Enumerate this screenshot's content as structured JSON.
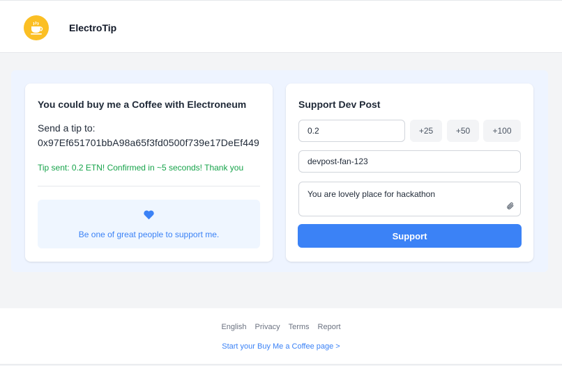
{
  "header": {
    "brand": "ElectroTip",
    "logo_icon": "coffee-cup-icon",
    "logo_color": "#fbbf24"
  },
  "info_card": {
    "title": "You could buy me a Coffee with Electroneum",
    "send_label": "Send a tip to:",
    "address": "0x97Ef651701bbA98a65f3fd0500f739e17DeEf449",
    "status": "Tip sent: 0.2 ETN! Confirmed in ~5 seconds! Thank you",
    "status_color": "#16a34a",
    "supporters_icon": "heart-icon",
    "supporters_text": "Be one of great people to support me."
  },
  "support_card": {
    "title": "Support Dev Post",
    "amount_value": "0.2",
    "presets": [
      "+25",
      "+50",
      "+100"
    ],
    "name_value": "devpost-fan-123",
    "message_value": "You are lovely place for hackathon",
    "attach_icon": "paperclip-icon",
    "button_label": "Support",
    "accent_color": "#3b82f6"
  },
  "footer": {
    "links": [
      "English",
      "Privacy",
      "Terms",
      "Report"
    ],
    "cta": "Start your Buy Me a Coffee page >"
  }
}
